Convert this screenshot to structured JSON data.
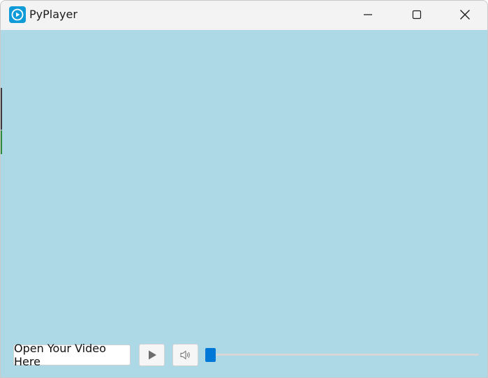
{
  "window": {
    "title": "PyPlayer",
    "icon": "play-circle-icon",
    "controls": [
      "minimize-icon",
      "maximize-icon",
      "close-icon"
    ]
  },
  "video": {
    "background_color": "#add8e6"
  },
  "controls": {
    "open_label": "Open Your Video Here",
    "play_icon": "play-icon",
    "volume_icon": "speaker-icon",
    "position_fraction": 0.0,
    "accent_color": "#0078d7"
  }
}
